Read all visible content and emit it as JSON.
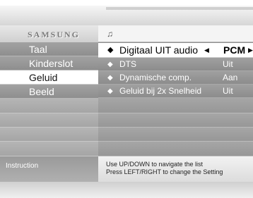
{
  "brand": {
    "logo_text": "SAMSUNG"
  },
  "header": {
    "icon": "music-note-icon"
  },
  "sidebar": {
    "items": [
      {
        "label": "Taal"
      },
      {
        "label": "Kinderslot"
      },
      {
        "label": "Geluid",
        "selected": true
      },
      {
        "label": "Beeld"
      }
    ]
  },
  "options": {
    "rows": [
      {
        "label": "Digitaal UIT audio",
        "value": "PCM",
        "selected": true
      },
      {
        "label": "DTS",
        "value": "Uit"
      },
      {
        "label": "Dynamische comp.",
        "value": "Aan"
      },
      {
        "label": "Geluid bij 2x Snelheid",
        "value": "Uit"
      }
    ]
  },
  "instruction": {
    "label": "Instruction",
    "line1": "Use UP/DOWN to navigate the list",
    "line2": "Press LEFT/RIGHT to change the Setting"
  },
  "colors": {
    "menu_grey": "#9a9a9a",
    "selected_bg": "#ffffff",
    "text_white": "#ffffff"
  }
}
